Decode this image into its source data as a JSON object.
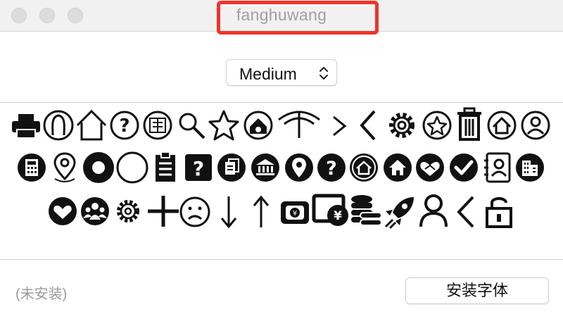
{
  "window": {
    "title": "fanghuwang",
    "highlight_color": "#f0332a"
  },
  "size_select": {
    "selected": "Medium"
  },
  "glyph_rows": [
    [
      "printer-icon",
      "user-outline-icon",
      "home-outline-icon",
      "help-circle-icon",
      "review-badge-icon",
      "search-icon",
      "star-outline-icon",
      "home-wifi-icon",
      "signal-icon",
      "chevron-right-icon",
      "chevron-left-icon",
      "gear-icon",
      "star-circle-icon",
      "trash-icon",
      "home-circle-icon",
      "user-circle-icon"
    ],
    [
      "calculator-icon",
      "map-pin-outline-icon",
      "record-filled-icon",
      "circle-outline-icon",
      "clipboard-icon",
      "help-square-icon",
      "documents-icon",
      "bank-icon",
      "location-filled-icon",
      "help-filled-icon",
      "home-sync-icon",
      "home-filled-icon",
      "handshake-icon",
      "check-circle-icon",
      "contact-card-icon",
      "building-icon"
    ],
    [
      "heart-hands-icon",
      "team-icon",
      "settings-icon",
      "plus-icon",
      "sad-face-icon",
      "arrow-down-icon",
      "arrow-up-icon",
      "wallet-icon",
      "yen-card-icon",
      "coins-icon",
      "rocket-icon",
      "person-icon",
      "back-chevron-icon",
      "unlock-icon"
    ]
  ],
  "footer": {
    "status": "(未安装)",
    "install_label": "安装字体"
  }
}
